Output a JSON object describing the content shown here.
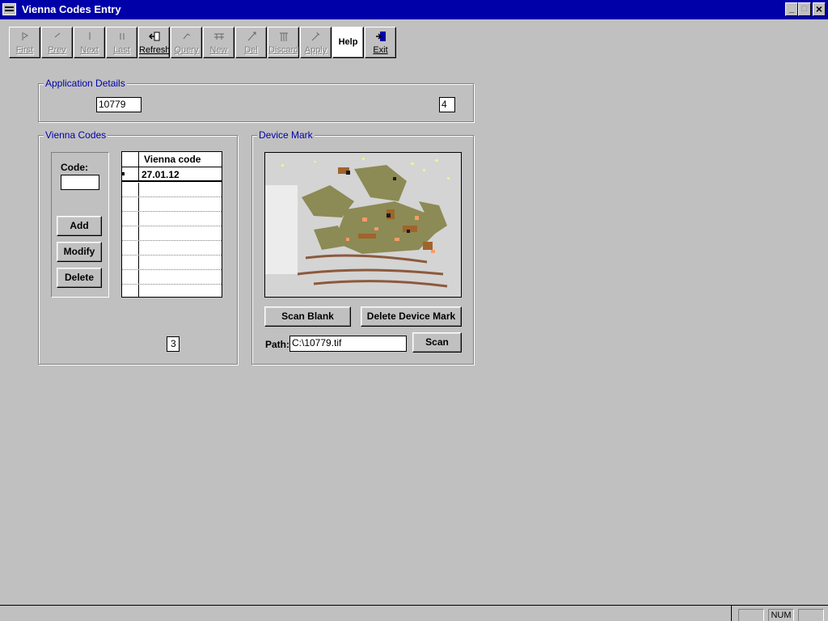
{
  "window": {
    "title": "Vienna Codes Entry"
  },
  "toolbar": {
    "buttons": [
      {
        "label": "First",
        "icon": "first-record-icon",
        "enabled": false
      },
      {
        "label": "Prev",
        "icon": "prev-record-icon",
        "enabled": false
      },
      {
        "label": "Next",
        "icon": "next-record-icon",
        "enabled": false
      },
      {
        "label": "Last",
        "icon": "last-record-icon",
        "enabled": false
      },
      {
        "label": "Refresh",
        "icon": "refresh-icon",
        "enabled": true
      },
      {
        "label": "Query",
        "icon": "query-icon",
        "enabled": false
      },
      {
        "label": "New",
        "icon": "new-record-icon",
        "enabled": false
      },
      {
        "label": "Del",
        "icon": "delete-icon",
        "enabled": false
      },
      {
        "label": "Discard",
        "icon": "discard-icon",
        "enabled": false
      },
      {
        "label": "Apply",
        "icon": "apply-icon",
        "enabled": false
      },
      {
        "label": "Help",
        "icon": "",
        "enabled": true
      },
      {
        "label": "Exit",
        "icon": "exit-door-icon",
        "enabled": true
      }
    ]
  },
  "application_details": {
    "legend": "Application Details",
    "application_number": "10779",
    "count": "4"
  },
  "vienna_codes": {
    "legend": "Vienna Codes",
    "code_label": "Code:",
    "code_value": "",
    "add_label": "Add",
    "modify_label": "Modify",
    "delete_label": "Delete",
    "grid_header": "Vienna code",
    "rows": [
      "27.01.12",
      "",
      "",
      "",
      "",
      "",
      "",
      "",
      ""
    ],
    "record_count": "3"
  },
  "device_mark": {
    "legend": "Device Mark",
    "scan_blank_label": "Scan Blank",
    "delete_mark_label": "Delete Device Mark",
    "path_label": "Path:",
    "path_value": "C:\\10779.tif",
    "scan_label": "Scan"
  },
  "status_bar": {
    "panels": [
      "",
      "NUM",
      ""
    ]
  },
  "colors": {
    "title_bar": "#0000a8",
    "face": "#c0c0c0",
    "legend_text": "#0000a8"
  }
}
